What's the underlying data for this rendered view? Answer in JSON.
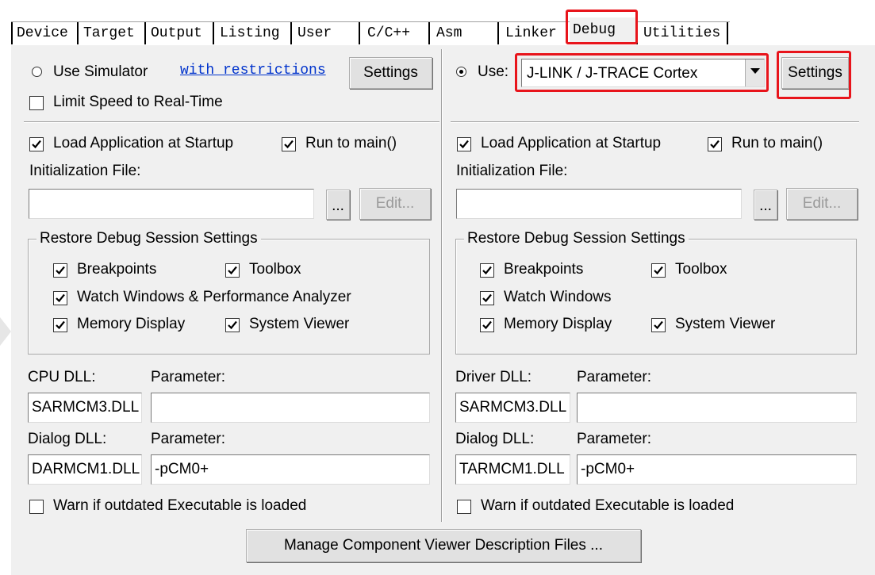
{
  "tabs": [
    "Device",
    "Target",
    "Output",
    "Listing",
    "User",
    "C/C++",
    "Asm",
    "Linker",
    "Debug",
    "Utilities"
  ],
  "active_tab": "Debug",
  "left": {
    "use_simulator_label": "Use Simulator",
    "use_simulator_selected": false,
    "restrictions_link": "with restrictions",
    "settings_label": "Settings",
    "limit_speed_label": "Limit Speed to Real-Time",
    "limit_speed_checked": false,
    "load_app_label": "Load Application at Startup",
    "load_app_checked": true,
    "run_main_label": "Run to main()",
    "run_main_checked": true,
    "init_file_label": "Initialization File:",
    "init_file_value": "",
    "browse_label": "...",
    "edit_label": "Edit...",
    "restore_title": "Restore Debug Session Settings",
    "breakpoints_label": "Breakpoints",
    "toolbox_label": "Toolbox",
    "watch_label": "Watch Windows & Performance Analyzer",
    "memory_label": "Memory Display",
    "sysviewer_label": "System Viewer",
    "dll_label": "CPU DLL:",
    "dll_param_label": "Parameter:",
    "dll_value": "SARMCM3.DLL",
    "dll_param_value": "",
    "dialog_label": "Dialog DLL:",
    "dialog_param_label": "Parameter:",
    "dialog_value": "DARMCM1.DLL",
    "dialog_param_value": "-pCM0+",
    "warn_label": "Warn if outdated Executable is loaded",
    "warn_checked": false
  },
  "right": {
    "use_label": "Use:",
    "use_selected": true,
    "debugger_value": "J-LINK / J-TRACE Cortex",
    "settings_label": "Settings",
    "load_app_label": "Load Application at Startup",
    "load_app_checked": true,
    "run_main_label": "Run to main()",
    "run_main_checked": true,
    "init_file_label": "Initialization File:",
    "init_file_value": "",
    "browse_label": "...",
    "edit_label": "Edit...",
    "restore_title": "Restore Debug Session Settings",
    "breakpoints_label": "Breakpoints",
    "toolbox_label": "Toolbox",
    "watch_label": "Watch Windows",
    "memory_label": "Memory Display",
    "sysviewer_label": "System Viewer",
    "dll_label": "Driver DLL:",
    "dll_param_label": "Parameter:",
    "dll_value": "SARMCM3.DLL",
    "dll_param_value": "",
    "dialog_label": "Dialog DLL:",
    "dialog_param_label": "Parameter:",
    "dialog_value": "TARMCM1.DLL",
    "dialog_param_value": "-pCM0+",
    "warn_label": "Warn if outdated Executable is loaded",
    "warn_checked": false
  },
  "manage_button": "Manage Component Viewer Description Files ...",
  "colors": {
    "highlight": "#e8141b",
    "link": "#0033cc",
    "panel": "#f0f0f0"
  }
}
